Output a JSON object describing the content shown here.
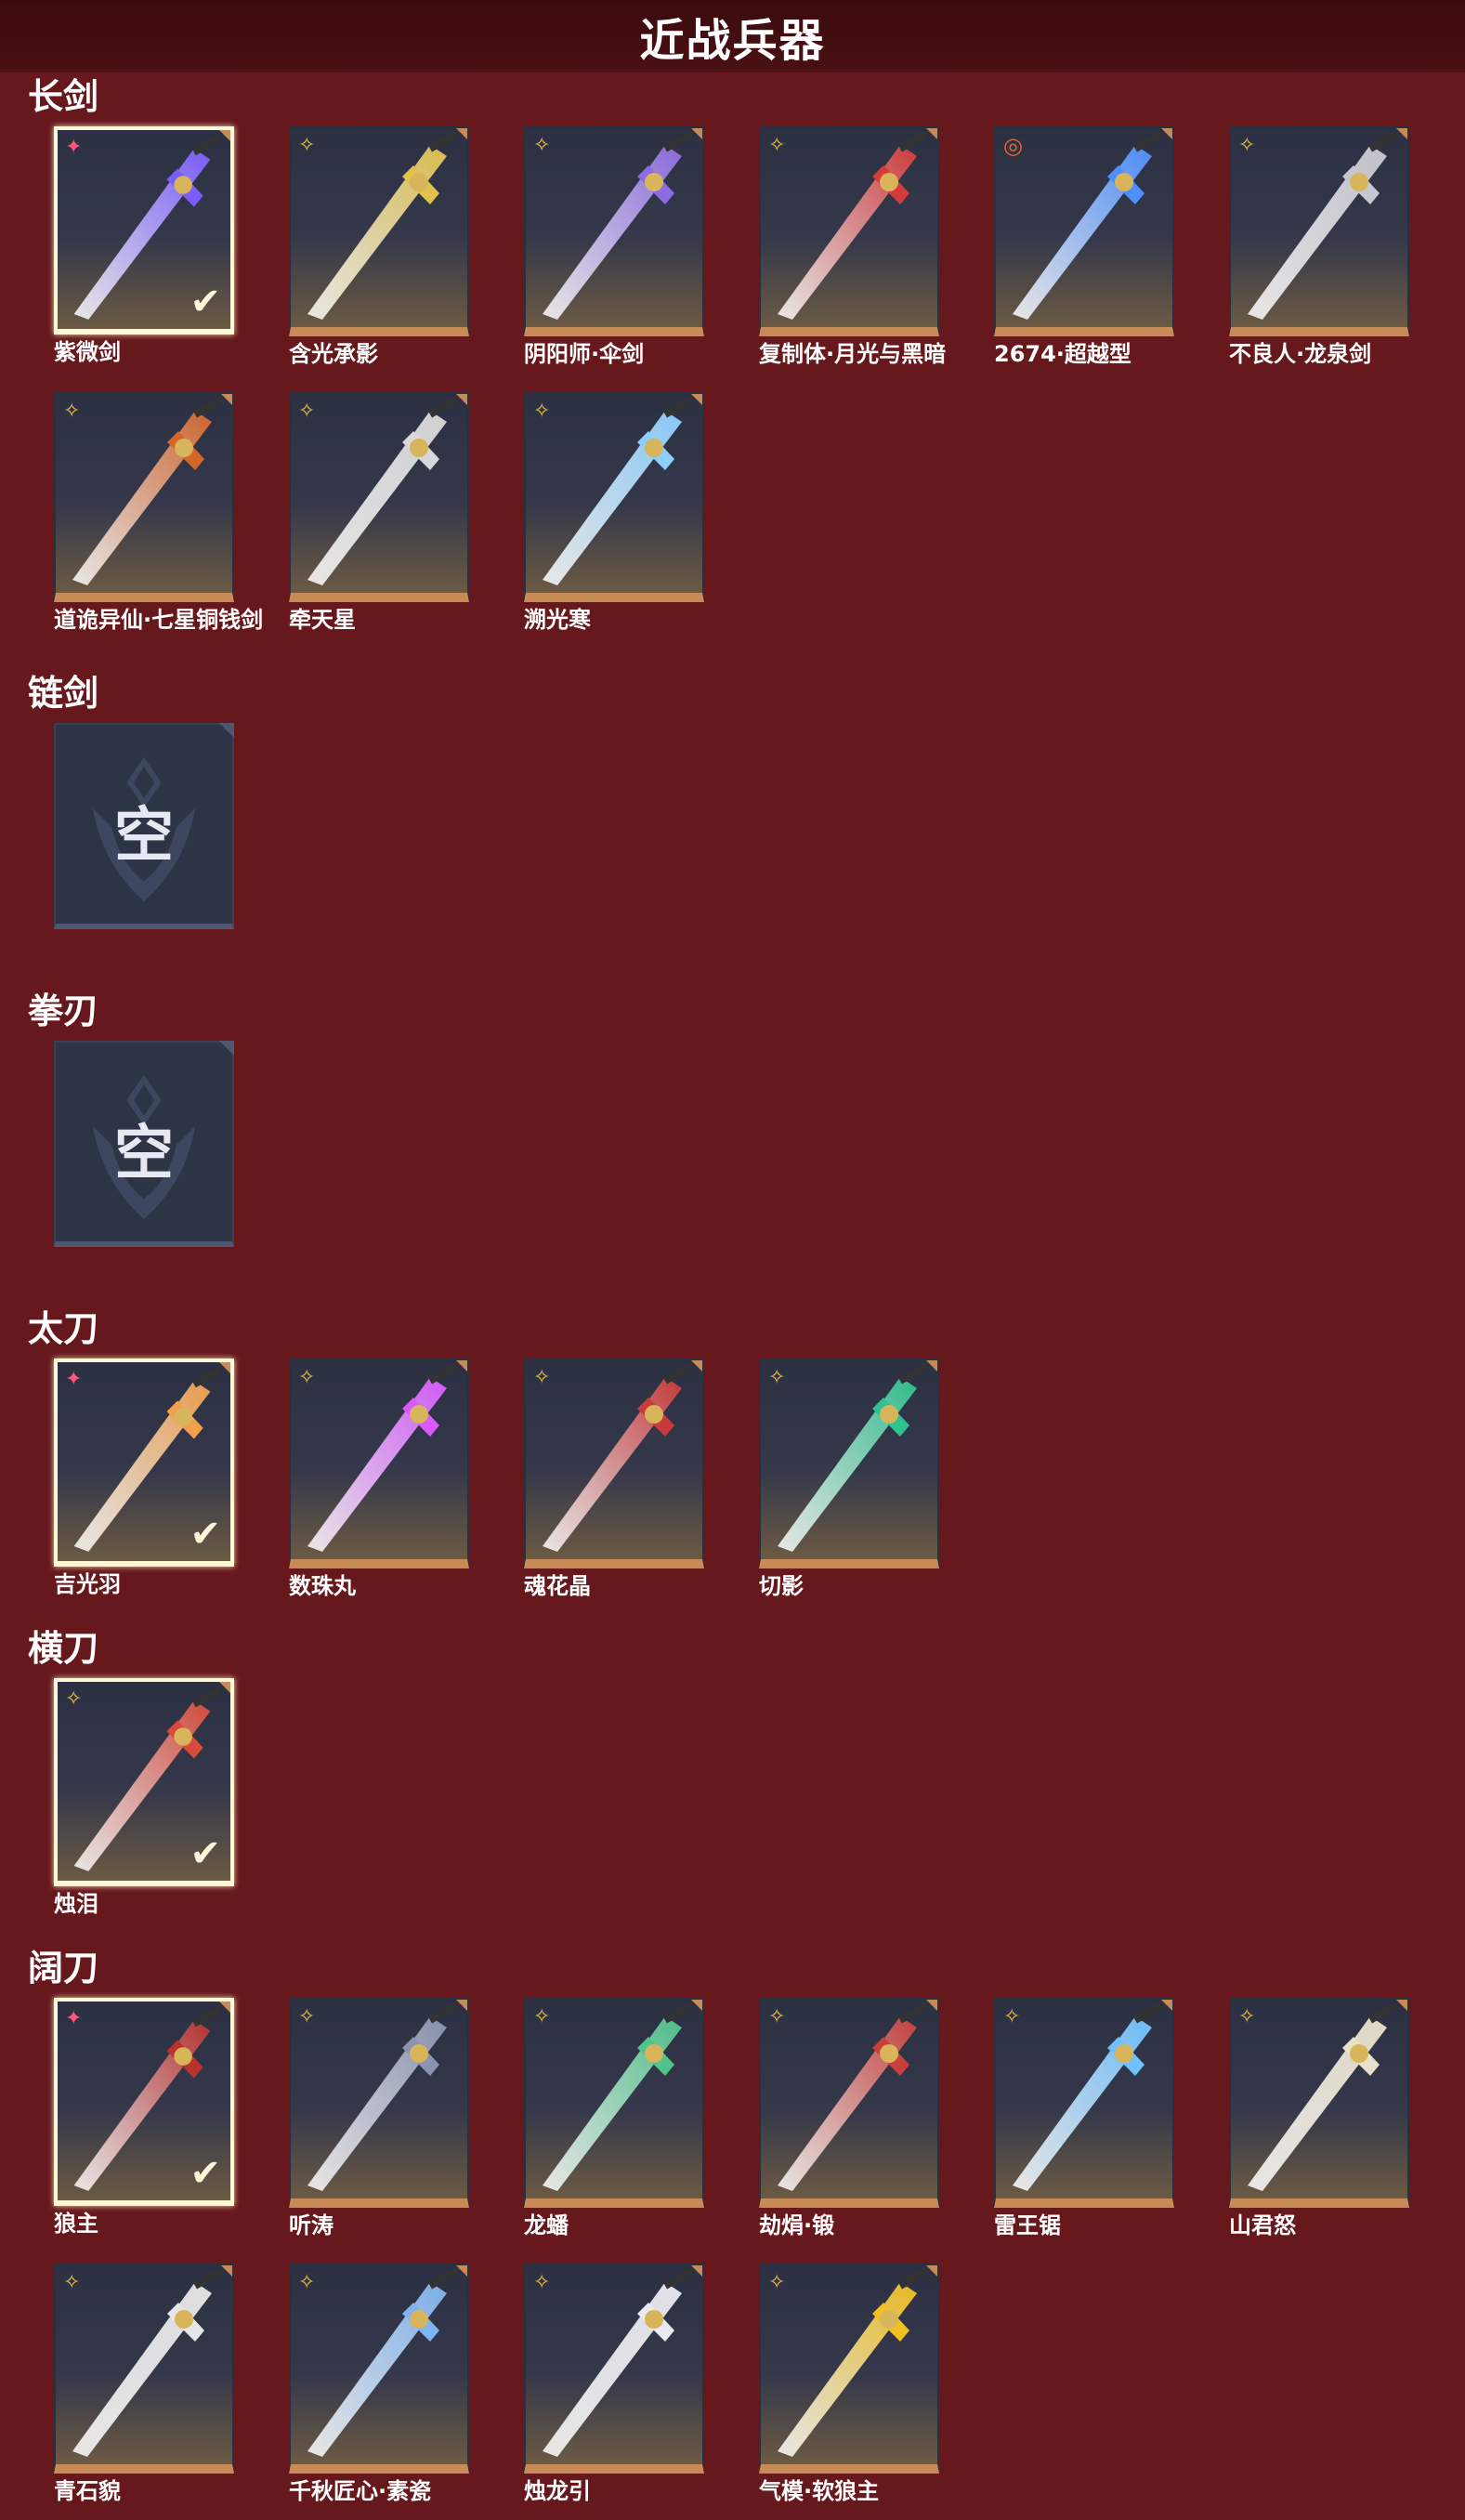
{
  "header": {
    "title": "近战兵器"
  },
  "colors": {
    "background": "#67181d",
    "header": "#3a0b0e",
    "frame": "#c88a57"
  },
  "sections": [
    {
      "category": "长剑",
      "items": [
        {
          "name": "紫微剑",
          "rarity": "pink-star",
          "equipped": true,
          "color": "#7a5cff"
        },
        {
          "name": "含光承影",
          "rarity": "gold-star",
          "equipped": false,
          "color": "#e0c24d"
        },
        {
          "name": "阴阳师·伞剑",
          "rarity": "gold-star",
          "equipped": false,
          "color": "#8e6be0"
        },
        {
          "name": "复制体·月光与黑暗",
          "rarity": "gold-star",
          "equipped": false,
          "color": "#d43b3b"
        },
        {
          "name": "2674·超越型",
          "rarity": "color-ring",
          "equipped": false,
          "color": "#4c8fff"
        },
        {
          "name": "不良人·龙泉剑",
          "rarity": "gold-star",
          "equipped": false,
          "color": "#c7c7d1"
        },
        {
          "name": "道诡异仙·七星铜钱剑",
          "rarity": "gold-star",
          "equipped": false,
          "color": "#d4662b"
        },
        {
          "name": "牵天星",
          "rarity": "gold-star",
          "equipped": false,
          "color": "#d8d8d8"
        },
        {
          "name": "溯光寒",
          "rarity": "gold-star",
          "equipped": false,
          "color": "#8ccfff"
        }
      ]
    },
    {
      "category": "链剑",
      "empty_label": "空",
      "items": []
    },
    {
      "category": "拳刃",
      "empty_label": "空",
      "items": []
    },
    {
      "category": "太刀",
      "items": [
        {
          "name": "吉光羽",
          "rarity": "pink-star",
          "equipped": true,
          "color": "#f0a04d"
        },
        {
          "name": "数珠丸",
          "rarity": "gold-star",
          "equipped": false,
          "color": "#d85aff"
        },
        {
          "name": "魂花晶",
          "rarity": "gold-star",
          "equipped": false,
          "color": "#c93a3a"
        },
        {
          "name": "切影",
          "rarity": "gold-star",
          "equipped": false,
          "color": "#2fc28e"
        }
      ]
    },
    {
      "category": "横刀",
      "items": [
        {
          "name": "烛泪",
          "rarity": "gold-star",
          "equipped": true,
          "color": "#d84a3a"
        }
      ]
    },
    {
      "category": "阔刀",
      "items": [
        {
          "name": "狼主",
          "rarity": "pink-star",
          "equipped": true,
          "color": "#b8322f"
        },
        {
          "name": "听涛",
          "rarity": "gold-star",
          "equipped": false,
          "color": "#8a93b0"
        },
        {
          "name": "龙蟠",
          "rarity": "gold-star",
          "equipped": false,
          "color": "#4fc48a"
        },
        {
          "name": "劫焆·锻",
          "rarity": "gold-star",
          "equipped": false,
          "color": "#c9403a"
        },
        {
          "name": "雷王锯",
          "rarity": "gold-star",
          "equipped": false,
          "color": "#6ec0ff"
        },
        {
          "name": "山君怒",
          "rarity": "gold-star",
          "equipped": false,
          "color": "#e8e0c8"
        },
        {
          "name": "青石貌",
          "rarity": "gold-star",
          "equipped": false,
          "color": "#e6e6e6"
        },
        {
          "name": "千秋匠心·素瓷",
          "rarity": "gold-star",
          "equipped": false,
          "color": "#7fb4f0"
        },
        {
          "name": "烛龙引",
          "rarity": "gold-star",
          "equipped": false,
          "color": "#e9e9ee"
        },
        {
          "name": "气模·软狼主",
          "rarity": "gold-star",
          "equipped": false,
          "color": "#f0c020"
        }
      ]
    }
  ]
}
